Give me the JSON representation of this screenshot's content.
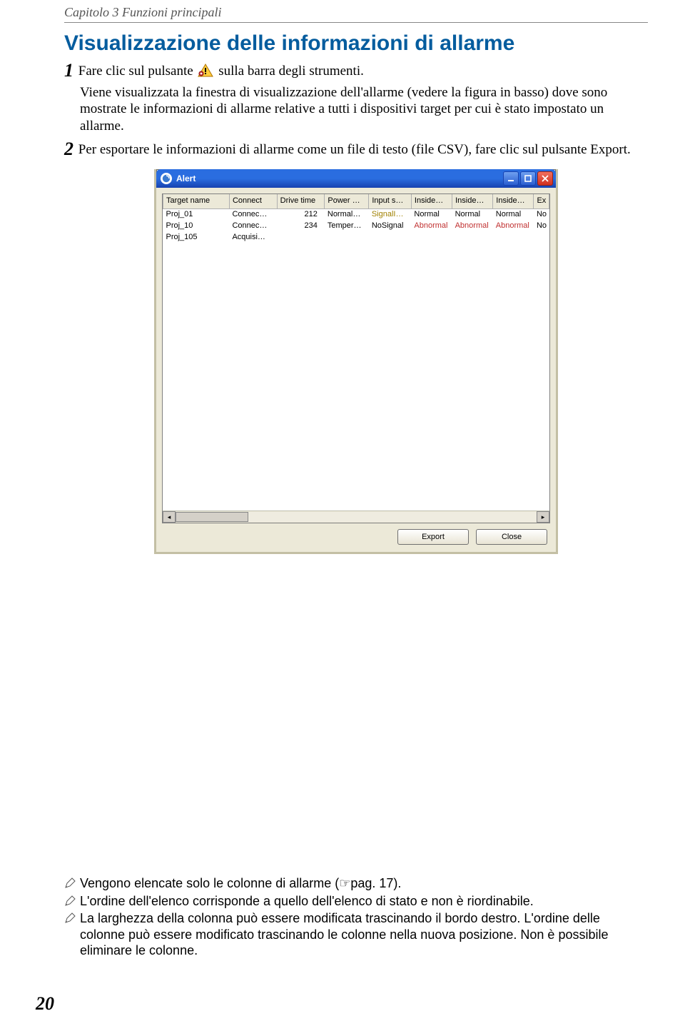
{
  "chapter": "Capitolo 3 Funzioni principali",
  "section_title": "Visualizzazione delle informazioni di allarme",
  "step1_a": "Fare clic sul pulsante",
  "step1_b": "sulla barra degli strumenti.",
  "para1": "Viene visualizzata la finestra di visualizzazione dell'allarme (vedere la figura in basso) dove sono mostrate le informazioni di allarme relative a tutti i dispositivi target per cui è stato impostato un allarme.",
  "step2": "Per esportare le informazioni di allarme come un file di testo (file CSV), fare clic sul pulsante Export.",
  "alert_window": {
    "title": "Alert",
    "columns": [
      "Target name",
      "Connect",
      "Drive time",
      "Power …",
      "Input s…",
      "Inside…",
      "Inside…",
      "Inside…",
      "Ex"
    ],
    "rows": [
      {
        "target": "Proj_01",
        "connect": "Connec…",
        "drive": "212",
        "power": "Normal…",
        "input": "SignalI…",
        "i1": "Normal",
        "i2": "Normal",
        "i3": "Normal",
        "ex": "No",
        "input_cls": "sig"
      },
      {
        "target": "Proj_10",
        "connect": "Connec…",
        "drive": "234",
        "power": "Temper…",
        "input": "NoSignal",
        "i1": "Abnormal",
        "i2": "Abnormal",
        "i3": "Abnormal",
        "ex": "No",
        "abn": true
      },
      {
        "target": "Proj_105",
        "connect": "Acquisi…",
        "drive": "",
        "power": "",
        "input": "",
        "i1": "",
        "i2": "",
        "i3": "",
        "ex": ""
      }
    ],
    "buttons": {
      "export": "Export",
      "close": "Close"
    }
  },
  "notes": [
    "Vengono elencate solo le colonne di allarme (☞pag. 17).",
    "L'ordine dell'elenco corrisponde a quello dell'elenco di stato e non è riordinabile.",
    "La larghezza della colonna può essere modificata trascinando il bordo destro. L'ordine delle colonne può essere modificato trascinando le colonne nella nuova posizione. Non è possibile eliminare le colonne."
  ],
  "page_number": "20"
}
